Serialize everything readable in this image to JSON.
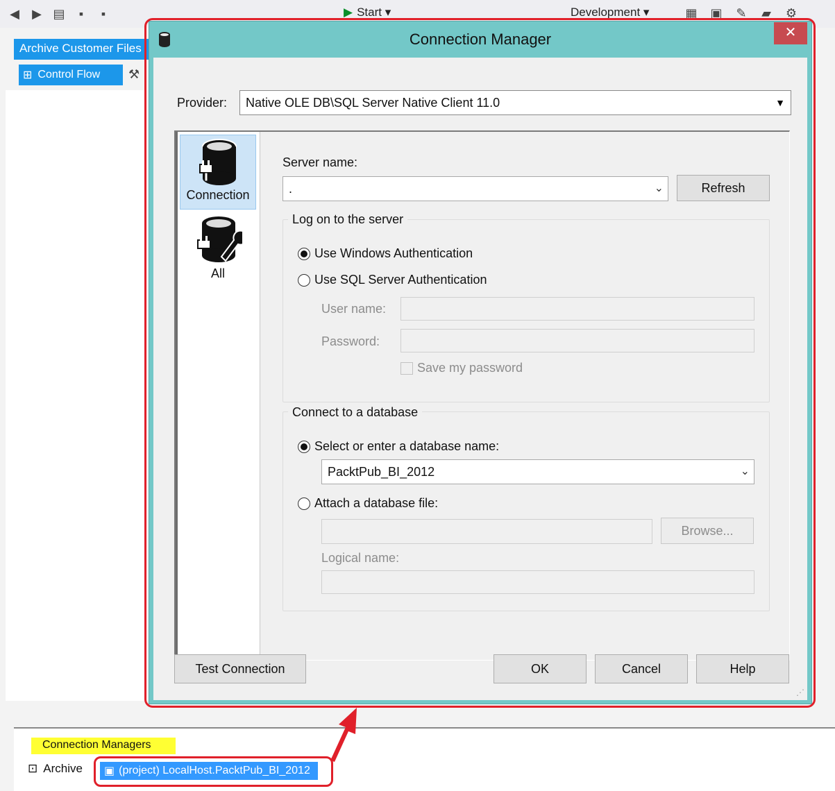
{
  "ide": {
    "start_label": "Start",
    "config_label": "Development",
    "document_tab": "Archive Customer Files",
    "designer_tab": "Control Flow",
    "connection_managers_tab": "Connection Managers",
    "archive_item": "Archive",
    "selected_connection": "(project) LocalHost.PacktPub_BI_2012"
  },
  "dialog": {
    "title": "Connection Manager",
    "close_glyph": "✕",
    "provider_label": "Provider:",
    "provider_value": "Native OLE DB\\SQL Server Native Client 11.0",
    "nav": [
      {
        "label": "Connection",
        "selected": true
      },
      {
        "label": "All",
        "selected": false
      }
    ],
    "server": {
      "label": "Server name:",
      "value": ".",
      "refresh": "Refresh"
    },
    "logon": {
      "title": "Log on to the server",
      "windows_auth": "Use Windows Authentication",
      "sql_auth": "Use SQL Server Authentication",
      "username_label": "User name:",
      "password_label": "Password:",
      "save_password": "Save my password"
    },
    "database": {
      "title": "Connect to a database",
      "select_option": "Select or enter a database name:",
      "database_value": "PacktPub_BI_2012",
      "attach_option": "Attach a database file:",
      "browse": "Browse...",
      "logical_label": "Logical name:"
    },
    "buttons": {
      "test": "Test Connection",
      "ok": "OK",
      "cancel": "Cancel",
      "help": "Help"
    }
  },
  "colors": {
    "title_bar": "#73c8c8",
    "close_button": "#c74b50",
    "highlight_outline": "#e0202a",
    "selection_blue": "#3399ff",
    "tab_blue": "#1c97ea",
    "yellow_highlight": "#ffff33"
  }
}
